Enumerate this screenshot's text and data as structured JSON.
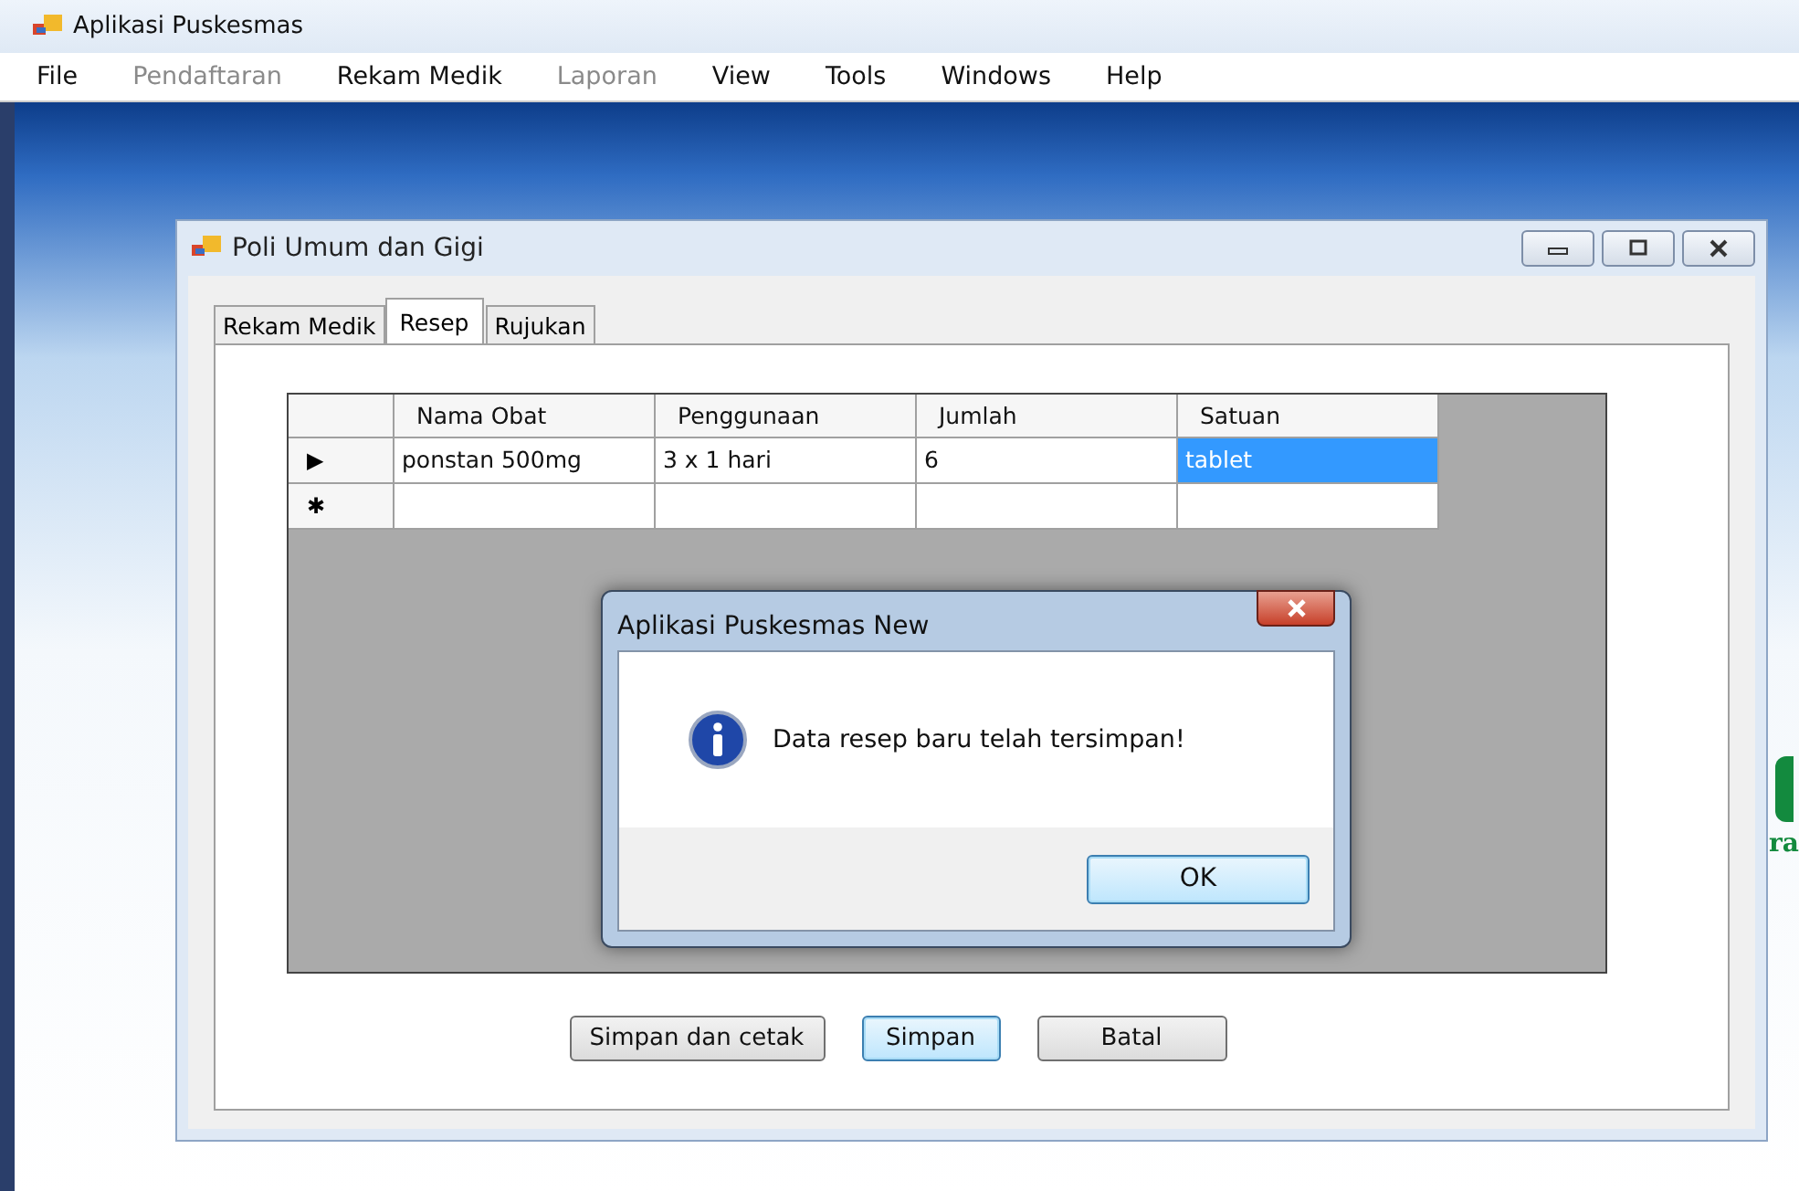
{
  "app": {
    "title": "Aplikasi Puskesmas"
  },
  "menu": [
    {
      "label": "File",
      "disabled": false
    },
    {
      "label": "Pendaftaran",
      "disabled": true
    },
    {
      "label": "Rekam Medik",
      "disabled": false
    },
    {
      "label": "Laporan",
      "disabled": true
    },
    {
      "label": "View",
      "disabled": false
    },
    {
      "label": "Tools",
      "disabled": false
    },
    {
      "label": "Windows",
      "disabled": false
    },
    {
      "label": "Help",
      "disabled": false
    }
  ],
  "background_text": "ra",
  "child_window": {
    "title": "Poli Umum dan Gigi",
    "tabs": [
      {
        "label": "Rekam Medik",
        "selected": false
      },
      {
        "label": "Resep",
        "selected": true
      },
      {
        "label": "Rujukan",
        "selected": false
      }
    ],
    "table": {
      "columns": [
        "Nama Obat",
        "Penggunaan",
        "Jumlah",
        "Satuan"
      ],
      "rows": [
        {
          "marker": "▶",
          "cells": [
            {
              "text": "ponstan 500mg",
              "selected": false
            },
            {
              "text": "3 x 1 hari",
              "selected": false
            },
            {
              "text": "6",
              "selected": false
            },
            {
              "text": "tablet",
              "selected": true
            }
          ]
        },
        {
          "marker": "✱",
          "cells": []
        }
      ]
    },
    "buttons": [
      {
        "label": "Simpan dan cetak",
        "default": false
      },
      {
        "label": "Simpan",
        "default": true
      },
      {
        "label": "Batal",
        "default": false
      }
    ]
  },
  "dialog": {
    "title": "Aplikasi Puskesmas New",
    "message": "Data resep baru telah tersimpan!",
    "button": "OK"
  }
}
